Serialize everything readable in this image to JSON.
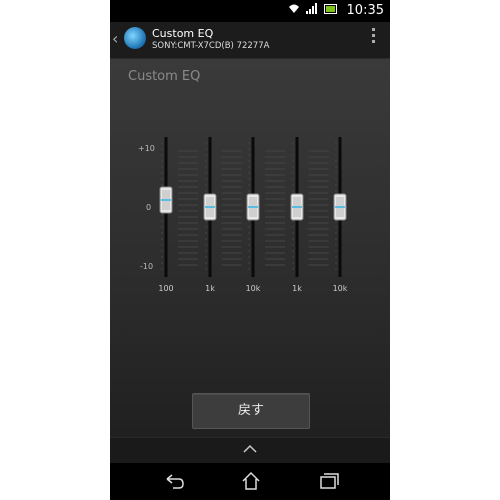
{
  "status": {
    "time": "10:35"
  },
  "header": {
    "title": "Custom EQ",
    "subtitle": "SONY:CMT-X7CD(B) 72277A"
  },
  "content": {
    "heading": "Custom EQ"
  },
  "eq": {
    "scale": {
      "max": "+10",
      "mid": "0",
      "min": "-10"
    },
    "bands": [
      {
        "label": "100",
        "value": 1
      },
      {
        "label": "1k",
        "value": 0
      },
      {
        "label": "10k",
        "value": 0
      },
      {
        "label": "1k",
        "value": 0
      },
      {
        "label": "10k",
        "value": 0
      }
    ]
  },
  "actions": {
    "reset_label": "戻す"
  },
  "icons": {
    "back": "chevron-left-icon",
    "menu": "overflow-menu-icon",
    "expand": "chevron-up-icon",
    "nav_back": "back-icon",
    "nav_home": "home-icon",
    "nav_recent": "recent-apps-icon"
  },
  "colors": {
    "accent": "#33b5e5",
    "background": "#2c2c2c"
  }
}
